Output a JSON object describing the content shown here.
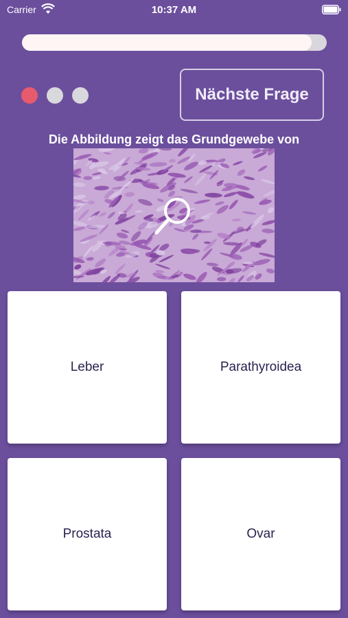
{
  "status_bar": {
    "carrier": "Carrier",
    "time": "10:37 AM"
  },
  "progress": {
    "fraction": 0.95
  },
  "question_dots": [
    {
      "state": "wrong",
      "color": "#e85a6e"
    },
    {
      "state": "pending",
      "color": "#d9d8dc"
    },
    {
      "state": "pending",
      "color": "#d9d8dc"
    }
  ],
  "next_button": {
    "label": "Nächste Frage"
  },
  "question": {
    "text": "Die Abbildung zeigt das Grundgewebe von"
  },
  "image": {
    "icon": "magnifier-icon"
  },
  "answers": [
    {
      "label": "Leber"
    },
    {
      "label": "Parathyroidea"
    },
    {
      "label": "Prostata"
    },
    {
      "label": "Ovar"
    }
  ],
  "colors": {
    "background": "#6b4f9d",
    "accent_wrong": "#e85a6e",
    "answer_text": "#2a2250"
  }
}
